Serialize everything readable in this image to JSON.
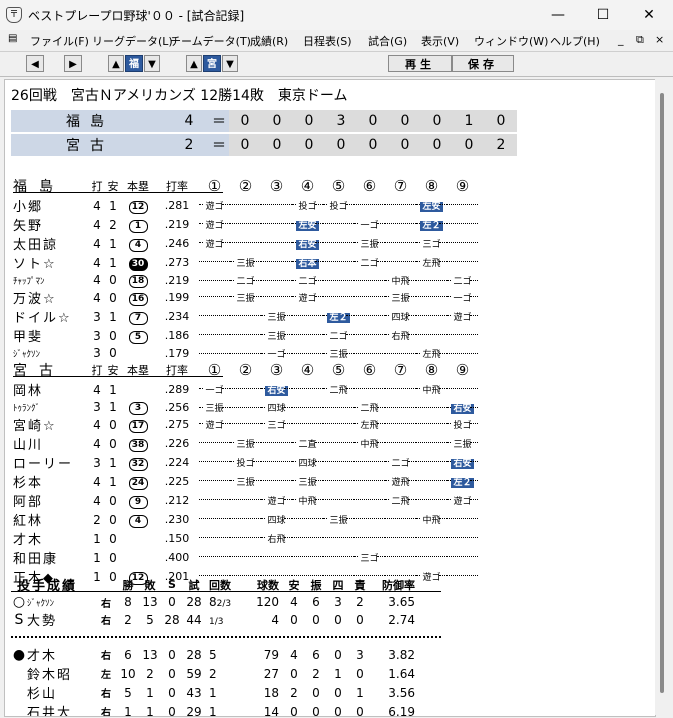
{
  "window": {
    "title": "ベストプレープロ野球'００ - [試合記録]",
    "icon_label": "〒",
    "minimize": "—",
    "maximize": "☐",
    "close": "✕"
  },
  "menu": {
    "items": [
      "ファイル(F)",
      "リーグデータ(L)",
      "チームデータ(T)",
      "成績(R)",
      "日程表(S)",
      "試合(G)",
      "表示(V)",
      "ウィンドウ(W)",
      "ヘルプ(H)"
    ],
    "mdi_min": "_",
    "mdi_restore": "⧉",
    "mdi_close": "×"
  },
  "toolbar": {
    "prev": "◀",
    "next": "▶",
    "team1_up": "▲",
    "team1": "福",
    "team1_down": "▼",
    "team2_up": "▲",
    "team2": "宮",
    "team2_down": "▼",
    "play": "再生",
    "save": "保存"
  },
  "game": {
    "header": "26回戦　宮古Ｎアメリカンズ 12勝14敗　東京ドーム"
  },
  "linescore": [
    {
      "team": "福島",
      "total": "4",
      "eq": "＝",
      "innings": [
        "0",
        "0",
        "0",
        "3",
        "0",
        "0",
        "0",
        "1",
        "0"
      ]
    },
    {
      "team": "宮古",
      "total": "2",
      "eq": "＝",
      "innings": [
        "0",
        "0",
        "0",
        "0",
        "0",
        "0",
        "0",
        "0",
        "2"
      ]
    }
  ],
  "batting_headers": {
    "ab": "打",
    "h": "安",
    "hr": "本塁",
    "avg": "打率",
    "innings": [
      "①",
      "②",
      "③",
      "④",
      "⑤",
      "⑥",
      "⑦",
      "⑧",
      "⑨"
    ]
  },
  "away_batting": {
    "team": "福島",
    "rows": [
      {
        "name": "小郷",
        "ab": "4",
        "h": "1",
        "hr": "12",
        "hr_filled": false,
        "avg": ".281",
        "pa": [
          [
            "遊ゴ",
            "r"
          ],
          [
            "",
            ""
          ],
          [
            "",
            ""
          ],
          [
            "投ゴ",
            "n"
          ],
          [
            "投ゴ",
            "n"
          ],
          [
            "",
            ""
          ],
          [
            "",
            ""
          ],
          [
            "左安",
            "h"
          ],
          [
            "",
            ""
          ]
        ]
      },
      {
        "name": "矢野",
        "ab": "4",
        "h": "2",
        "hr": "1",
        "hr_filled": false,
        "avg": ".219",
        "pa": [
          [
            "遊ゴ",
            "r"
          ],
          [
            "",
            ""
          ],
          [
            "",
            ""
          ],
          [
            "左安",
            "h"
          ],
          [
            "",
            ""
          ],
          [
            "一ゴ",
            "n"
          ],
          [
            "",
            ""
          ],
          [
            "左２",
            "h"
          ],
          [
            "",
            ""
          ]
        ]
      },
      {
        "name": "太田諒",
        "ab": "4",
        "h": "1",
        "hr": "4",
        "hr_filled": false,
        "avg": ".246",
        "pa": [
          [
            "遊ゴ",
            "r"
          ],
          [
            "",
            ""
          ],
          [
            "",
            ""
          ],
          [
            "右安",
            "h"
          ],
          [
            "",
            ""
          ],
          [
            "三振",
            "n"
          ],
          [
            "",
            ""
          ],
          [
            "三ゴ",
            "n"
          ],
          [
            "",
            ""
          ]
        ]
      },
      {
        "name": "ソト☆",
        "ab": "4",
        "h": "1",
        "hr": "30",
        "hr_filled": true,
        "avg": ".273",
        "pa": [
          [
            "",
            ""
          ],
          [
            "三振",
            "n"
          ],
          [
            "",
            ""
          ],
          [
            "右本",
            "h"
          ],
          [
            "",
            ""
          ],
          [
            "二ゴ",
            "n"
          ],
          [
            "",
            ""
          ],
          [
            "左飛",
            "n"
          ],
          [
            "",
            ""
          ]
        ]
      },
      {
        "name": "ﾁｬｯﾌﾟﾏﾝ",
        "small": true,
        "ab": "4",
        "h": "0",
        "hr": "18",
        "hr_filled": false,
        "avg": ".219",
        "pa": [
          [
            "",
            ""
          ],
          [
            "二ゴ",
            "n"
          ],
          [
            "",
            ""
          ],
          [
            "二ゴ",
            "n"
          ],
          [
            "",
            ""
          ],
          [
            "",
            ""
          ],
          [
            "中飛",
            "n"
          ],
          [
            "",
            ""
          ],
          [
            "二ゴ",
            "n"
          ]
        ]
      },
      {
        "name": "万波☆",
        "ab": "4",
        "h": "0",
        "hr": "16",
        "hr_filled": false,
        "avg": ".199",
        "pa": [
          [
            "",
            ""
          ],
          [
            "三振",
            "n"
          ],
          [
            "",
            ""
          ],
          [
            "遊ゴ",
            "n"
          ],
          [
            "",
            ""
          ],
          [
            "",
            ""
          ],
          [
            "三振",
            "n"
          ],
          [
            "",
            ""
          ],
          [
            "一ゴ",
            "n"
          ]
        ]
      },
      {
        "name": "ドイル☆",
        "ab": "3",
        "h": "1",
        "hr": "7",
        "hr_filled": false,
        "avg": ".234",
        "pa": [
          [
            "",
            ""
          ],
          [
            "",
            ""
          ],
          [
            "三振",
            "n"
          ],
          [
            "",
            ""
          ],
          [
            "左２",
            "h"
          ],
          [
            "",
            ""
          ],
          [
            "四球",
            "n"
          ],
          [
            "",
            ""
          ],
          [
            "遊ゴ",
            "n"
          ]
        ]
      },
      {
        "name": "甲斐",
        "ab": "3",
        "h": "0",
        "hr": "5",
        "hr_filled": false,
        "avg": ".186",
        "pa": [
          [
            "",
            ""
          ],
          [
            "",
            ""
          ],
          [
            "三振",
            "n"
          ],
          [
            "",
            ""
          ],
          [
            "二ゴ",
            "n"
          ],
          [
            "",
            ""
          ],
          [
            "右飛",
            "n"
          ],
          [
            "",
            ""
          ],
          [
            "",
            ""
          ]
        ]
      },
      {
        "name": "ｼﾞｬｸｿﾝ",
        "small": true,
        "ab": "3",
        "h": "0",
        "hr": "",
        "hr_filled": false,
        "avg": ".179",
        "pa": [
          [
            "",
            ""
          ],
          [
            "",
            ""
          ],
          [
            "一ゴ",
            "n"
          ],
          [
            "",
            ""
          ],
          [
            "三振",
            "n"
          ],
          [
            "",
            ""
          ],
          [
            "",
            ""
          ],
          [
            "左飛",
            "n"
          ],
          [
            "",
            ""
          ]
        ]
      }
    ]
  },
  "home_batting": {
    "team": "宮古",
    "rows": [
      {
        "name": "岡林",
        "ab": "4",
        "h": "1",
        "hr": "",
        "hr_filled": false,
        "avg": ".289",
        "pa": [
          [
            "一ゴ",
            "r"
          ],
          [
            "",
            ""
          ],
          [
            "右安",
            "h"
          ],
          [
            "",
            ""
          ],
          [
            "二飛",
            "n"
          ],
          [
            "",
            ""
          ],
          [
            "",
            ""
          ],
          [
            "中飛",
            "n"
          ],
          [
            "",
            ""
          ]
        ]
      },
      {
        "name": "ﾄｩﾗﾝｸﾞ",
        "small": true,
        "ab": "3",
        "h": "1",
        "hr": "3",
        "hr_filled": false,
        "avg": ".256",
        "pa": [
          [
            "三振",
            "r"
          ],
          [
            "",
            ""
          ],
          [
            "四球",
            "n"
          ],
          [
            "",
            ""
          ],
          [
            "",
            ""
          ],
          [
            "二飛",
            "n"
          ],
          [
            "",
            ""
          ],
          [
            "",
            ""
          ],
          [
            "右安",
            "h"
          ]
        ]
      },
      {
        "name": "宮崎☆",
        "ab": "4",
        "h": "0",
        "hr": "17",
        "hr_filled": false,
        "avg": ".275",
        "pa": [
          [
            "遊ゴ",
            "r"
          ],
          [
            "",
            ""
          ],
          [
            "三ゴ",
            "n"
          ],
          [
            "",
            ""
          ],
          [
            "",
            ""
          ],
          [
            "左飛",
            "n"
          ],
          [
            "",
            ""
          ],
          [
            "",
            ""
          ],
          [
            "投ゴ",
            "n"
          ]
        ]
      },
      {
        "name": "山川",
        "ab": "4",
        "h": "0",
        "hr": "38",
        "hr_filled": false,
        "avg": ".226",
        "pa": [
          [
            "",
            ""
          ],
          [
            "三振",
            "n"
          ],
          [
            "",
            ""
          ],
          [
            "二直",
            "n"
          ],
          [
            "",
            ""
          ],
          [
            "中飛",
            "n"
          ],
          [
            "",
            ""
          ],
          [
            "",
            ""
          ],
          [
            "三振",
            "n"
          ]
        ]
      },
      {
        "name": "ローリー",
        "ab": "3",
        "h": "1",
        "hr": "32",
        "hr_filled": false,
        "avg": ".224",
        "pa": [
          [
            "",
            ""
          ],
          [
            "投ゴ",
            "n"
          ],
          [
            "",
            ""
          ],
          [
            "四球",
            "n"
          ],
          [
            "",
            ""
          ],
          [
            "",
            ""
          ],
          [
            "二ゴ",
            "n"
          ],
          [
            "",
            ""
          ],
          [
            "右安",
            "h"
          ]
        ]
      },
      {
        "name": "杉本",
        "ab": "4",
        "h": "1",
        "hr": "24",
        "hr_filled": false,
        "avg": ".225",
        "pa": [
          [
            "",
            ""
          ],
          [
            "三振",
            "n"
          ],
          [
            "",
            ""
          ],
          [
            "三振",
            "n"
          ],
          [
            "",
            ""
          ],
          [
            "",
            ""
          ],
          [
            "遊飛",
            "n"
          ],
          [
            "",
            ""
          ],
          [
            "左２",
            "h"
          ]
        ]
      },
      {
        "name": "阿部",
        "ab": "4",
        "h": "0",
        "hr": "9",
        "hr_filled": false,
        "avg": ".212",
        "pa": [
          [
            "",
            ""
          ],
          [
            "",
            ""
          ],
          [
            "遊ゴ",
            "n"
          ],
          [
            "中飛",
            "n"
          ],
          [
            "",
            ""
          ],
          [
            "",
            ""
          ],
          [
            "二飛",
            "n"
          ],
          [
            "",
            ""
          ],
          [
            "遊ゴ",
            "n"
          ]
        ]
      },
      {
        "name": "紅林",
        "ab": "2",
        "h": "0",
        "hr": "4",
        "hr_filled": false,
        "avg": ".230",
        "pa": [
          [
            "",
            ""
          ],
          [
            "",
            ""
          ],
          [
            "四球",
            "n"
          ],
          [
            "",
            ""
          ],
          [
            "三振",
            "n"
          ],
          [
            "",
            ""
          ],
          [
            "",
            ""
          ],
          [
            "中飛",
            "n"
          ],
          [
            "",
            ""
          ]
        ]
      },
      {
        "name": "才木",
        "ab": "1",
        "h": "0",
        "hr": "",
        "hr_filled": false,
        "avg": ".150",
        "pa": [
          [
            "",
            ""
          ],
          [
            "",
            ""
          ],
          [
            "右飛",
            "n"
          ],
          [
            "",
            ""
          ],
          [
            "",
            ""
          ],
          [
            "",
            ""
          ],
          [
            "",
            ""
          ],
          [
            "",
            ""
          ],
          [
            "",
            ""
          ]
        ]
      },
      {
        "name": "和田康",
        "ab": "1",
        "h": "0",
        "hr": "",
        "hr_filled": false,
        "avg": ".400",
        "pa": [
          [
            "",
            ""
          ],
          [
            "",
            ""
          ],
          [
            "",
            ""
          ],
          [
            "",
            ""
          ],
          [
            "",
            ""
          ],
          [
            "三ゴ",
            "n"
          ],
          [
            "",
            ""
          ],
          [
            "",
            ""
          ],
          [
            "",
            ""
          ]
        ]
      },
      {
        "name": "正木◆",
        "ab": "1",
        "h": "0",
        "hr": "12",
        "hr_filled": false,
        "avg": ".201",
        "pa": [
          [
            "",
            ""
          ],
          [
            "",
            ""
          ],
          [
            "",
            ""
          ],
          [
            "",
            ""
          ],
          [
            "",
            ""
          ],
          [
            "",
            ""
          ],
          [
            "",
            ""
          ],
          [
            "遊ゴ",
            "n"
          ],
          [
            "",
            ""
          ]
        ]
      }
    ]
  },
  "pitching": {
    "title": "投手成績",
    "headers": [
      "勝",
      "敗",
      "S",
      "試",
      "回数",
      "球数",
      "安",
      "振",
      "四",
      "責",
      "防御率"
    ],
    "away": [
      {
        "mark": "○",
        "name": "ｼﾞｬｸｿﾝ",
        "small": true,
        "hand": "右",
        "w": "8",
        "l": "13",
        "s": "0",
        "g": "28",
        "ip_int": "8",
        "ip_frac": "2/3",
        "np": "120",
        "ha": "4",
        "so": "6",
        "bb": "3",
        "er": "2",
        "era": "3.65"
      },
      {
        "mark": "S",
        "name": "大勢",
        "hand": "右",
        "w": "2",
        "l": "5",
        "s": "28",
        "g": "44",
        "ip_int": "",
        "ip_frac": "1/3",
        "np": "4",
        "ha": "0",
        "so": "0",
        "bb": "0",
        "er": "0",
        "era": "2.74"
      }
    ],
    "home": [
      {
        "mark": "●",
        "name": "才木",
        "hand": "右",
        "w": "6",
        "l": "13",
        "s": "0",
        "g": "28",
        "ip_int": "5",
        "ip_frac": "",
        "np": "79",
        "ha": "4",
        "so": "6",
        "bb": "0",
        "er": "3",
        "era": "3.82"
      },
      {
        "mark": "",
        "name": "鈴木昭",
        "hand": "左",
        "w": "10",
        "l": "2",
        "s": "0",
        "g": "59",
        "ip_int": "2",
        "ip_frac": "",
        "np": "27",
        "ha": "0",
        "so": "2",
        "bb": "1",
        "er": "0",
        "era": "1.64"
      },
      {
        "mark": "",
        "name": "杉山",
        "hand": "右",
        "w": "5",
        "l": "1",
        "s": "0",
        "g": "43",
        "ip_int": "1",
        "ip_frac": "",
        "np": "18",
        "ha": "2",
        "so": "0",
        "bb": "0",
        "er": "1",
        "era": "3.56"
      },
      {
        "mark": "",
        "name": "石井大",
        "hand": "右",
        "w": "1",
        "l": "1",
        "s": "0",
        "g": "29",
        "ip_int": "1",
        "ip_frac": "",
        "np": "14",
        "ha": "0",
        "so": "0",
        "bb": "0",
        "er": "0",
        "era": "6.19"
      }
    ]
  }
}
